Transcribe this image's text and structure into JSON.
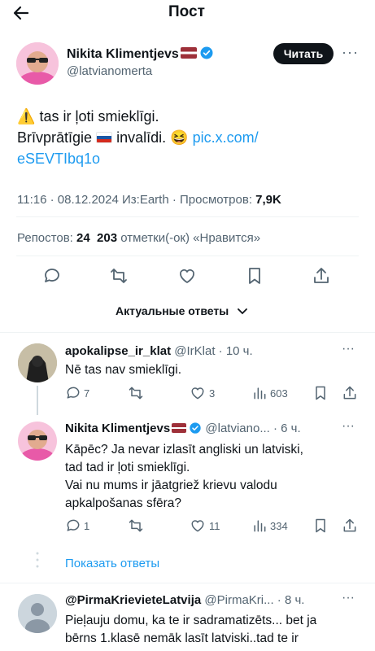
{
  "header": {
    "title": "Пост"
  },
  "post": {
    "author_name": "Nikita Klimentjevs",
    "author_handle": "@latvianomerta",
    "follow_label": "Читать",
    "warning_glyph": "⚠️",
    "text_line1": "tas ir ļoti smieklīgi.",
    "text_line2a": "Brīvprātīgie",
    "text_line2b": "invalīdi.",
    "emoji": "😆",
    "link_part1": "pic.x.com/",
    "link_part2": "eSEVTIbq1o",
    "meta_time": "11:16 · 08.12.2024 Из:Earth · Просмотров:",
    "meta_views": "7,9K",
    "reposts_label": "Репостов:",
    "reposts_count": "24",
    "likes_count": "203",
    "likes_label": "отметки(-ок) «Нравится»"
  },
  "sort": {
    "label": "Актуальные ответы"
  },
  "replies": [
    {
      "name": "apokalipse_ir_klat",
      "handle": "@IrKlat · 10 ч.",
      "text": "Nē tas nav smieklīgi.",
      "replies_count": "7",
      "likes_count": "3",
      "views_count": "603"
    },
    {
      "name": "Nikita Klimentjevs",
      "handle": "@latviano... · 6 ч.",
      "text_lines": [
        "Kāpēc? Ja nevar izlasīt angliski un latviski,",
        "tad tad ir ļoti smieklīgi.",
        "Vai nu mums ir jāatgriež krievu valodu",
        "apkalpošanas sfēra?"
      ],
      "replies_count": "1",
      "likes_count": "11",
      "views_count": "334"
    },
    {
      "name": "@PirmaKrievieteLatvija",
      "handle": "@PirmaKri... · 8 ч.",
      "text_lines": [
        "Pieļauju domu, ka te ir sadramatizēts... bet ja",
        "bērns 1.klasē nemāk lasīt latviski..tad te ir"
      ]
    }
  ],
  "show_replies": {
    "label": "Показать ответы"
  },
  "colors": {
    "accent": "#1d9bf0",
    "text": "#0f1419",
    "muted": "#536471"
  }
}
